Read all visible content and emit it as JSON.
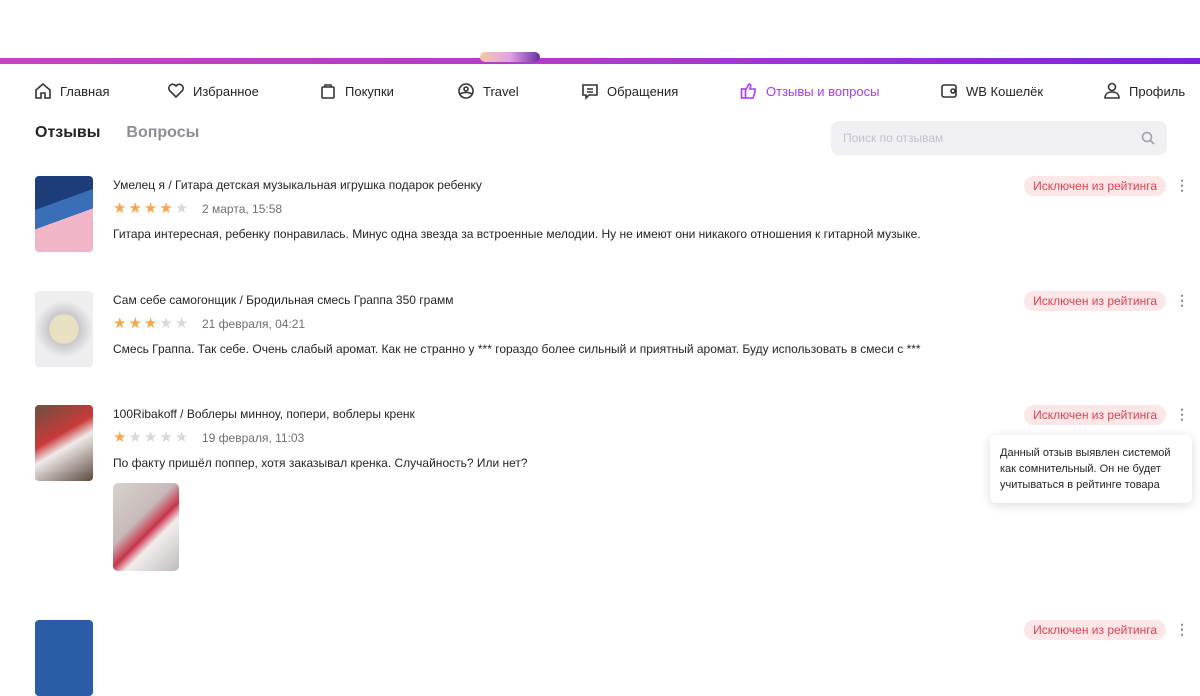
{
  "nav": {
    "items": [
      {
        "label": "Главная",
        "icon": "home-icon"
      },
      {
        "label": "Избранное",
        "icon": "heart-icon"
      },
      {
        "label": "Покупки",
        "icon": "bag-icon"
      },
      {
        "label": "Travel",
        "icon": "travel-icon"
      },
      {
        "label": "Обращения",
        "icon": "chat-icon"
      },
      {
        "label": "Отзывы и вопросы",
        "icon": "thumbs-up-icon",
        "active": true
      },
      {
        "label": "WB Кошелёк",
        "icon": "wallet-icon"
      },
      {
        "label": "Профиль",
        "icon": "user-icon"
      }
    ]
  },
  "tabs": {
    "reviews": "Отзывы",
    "questions": "Вопросы"
  },
  "search": {
    "placeholder": "Поиск по отзывам"
  },
  "accent": "#a73afd",
  "reviews": [
    {
      "title": "Умелец я / Гитара детская музыкальная игрушка подарок ребенку",
      "rating": 4,
      "date": "2 марта, 15:58",
      "text": "Гитара интересная, ребенку понравилась. Минус одна звезда за встроенные мелодии. Ну не имеют они никакого отношения к гитарной музыке.",
      "badge": "Исключен из рейтинга"
    },
    {
      "title": "Сам себе самогонщик / Бродильная смесь Граппа 350 грамм",
      "rating": 3,
      "date": "21 февраля, 04:21",
      "text": "Смесь Граппа. Так себе. Очень слабый аромат. Как не странно у *** гораздо более сильный и приятный аромат. Буду использовать в смеси с ***",
      "badge": "Исключен из рейтинга"
    },
    {
      "title": "100Ribakoff / Воблеры минноу, попери, воблеры кренк",
      "rating": 1,
      "date": "19 февраля, 11:03",
      "text": "По факту пришёл поппер, хотя заказывал кренка. Случайность? Или нет?",
      "badge": "Исключен из рейтинга"
    }
  ],
  "partial_badge": "Исключен из рейтинга",
  "tooltip": "Данный отзыв выявлен системой как сомнительный. Он не будет учитываться в рейтинге товара"
}
